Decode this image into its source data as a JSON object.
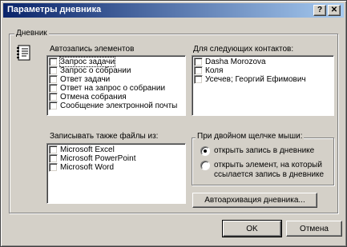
{
  "window": {
    "title": "Параметры дневника",
    "help_glyph": "?",
    "close_glyph": "✕"
  },
  "journal_group": {
    "legend": "Дневник",
    "autorecord": {
      "label": "Автозапись элементов",
      "items": [
        {
          "label": "Запрос задачи",
          "checked": false,
          "selected": true
        },
        {
          "label": "Запрос о собрании",
          "checked": false,
          "selected": false
        },
        {
          "label": "Ответ задачи",
          "checked": false,
          "selected": false
        },
        {
          "label": "Ответ на запрос о собрании",
          "checked": false,
          "selected": false
        },
        {
          "label": "Отмена собрания",
          "checked": false,
          "selected": false
        },
        {
          "label": "Сообщение электронной почты",
          "checked": false,
          "selected": false
        }
      ]
    },
    "contacts": {
      "label": "Для следующих контактов:",
      "items": [
        {
          "label": "Dasha Morozova",
          "checked": false
        },
        {
          "label": "Коля",
          "checked": false
        },
        {
          "label": "Усечев; Георгий Ефимович",
          "checked": false
        }
      ]
    },
    "files": {
      "label": "Записывать также файлы из:",
      "items": [
        {
          "label": "Microsoft Excel",
          "checked": false
        },
        {
          "label": "Microsoft PowerPoint",
          "checked": false
        },
        {
          "label": "Microsoft Word",
          "checked": false
        }
      ]
    },
    "double_click": {
      "legend": "При двойном щелчке мыши:",
      "option_open_entry": "открыть запись в дневнике",
      "option_open_item_line1": "открыть элемент, на который",
      "option_open_item_line2": "ссылается запись в дневнике",
      "selected": "open_entry"
    },
    "autoarchive_label": "Автоархивация дневника..."
  },
  "buttons": {
    "ok": "OK",
    "cancel": "Отмена"
  }
}
